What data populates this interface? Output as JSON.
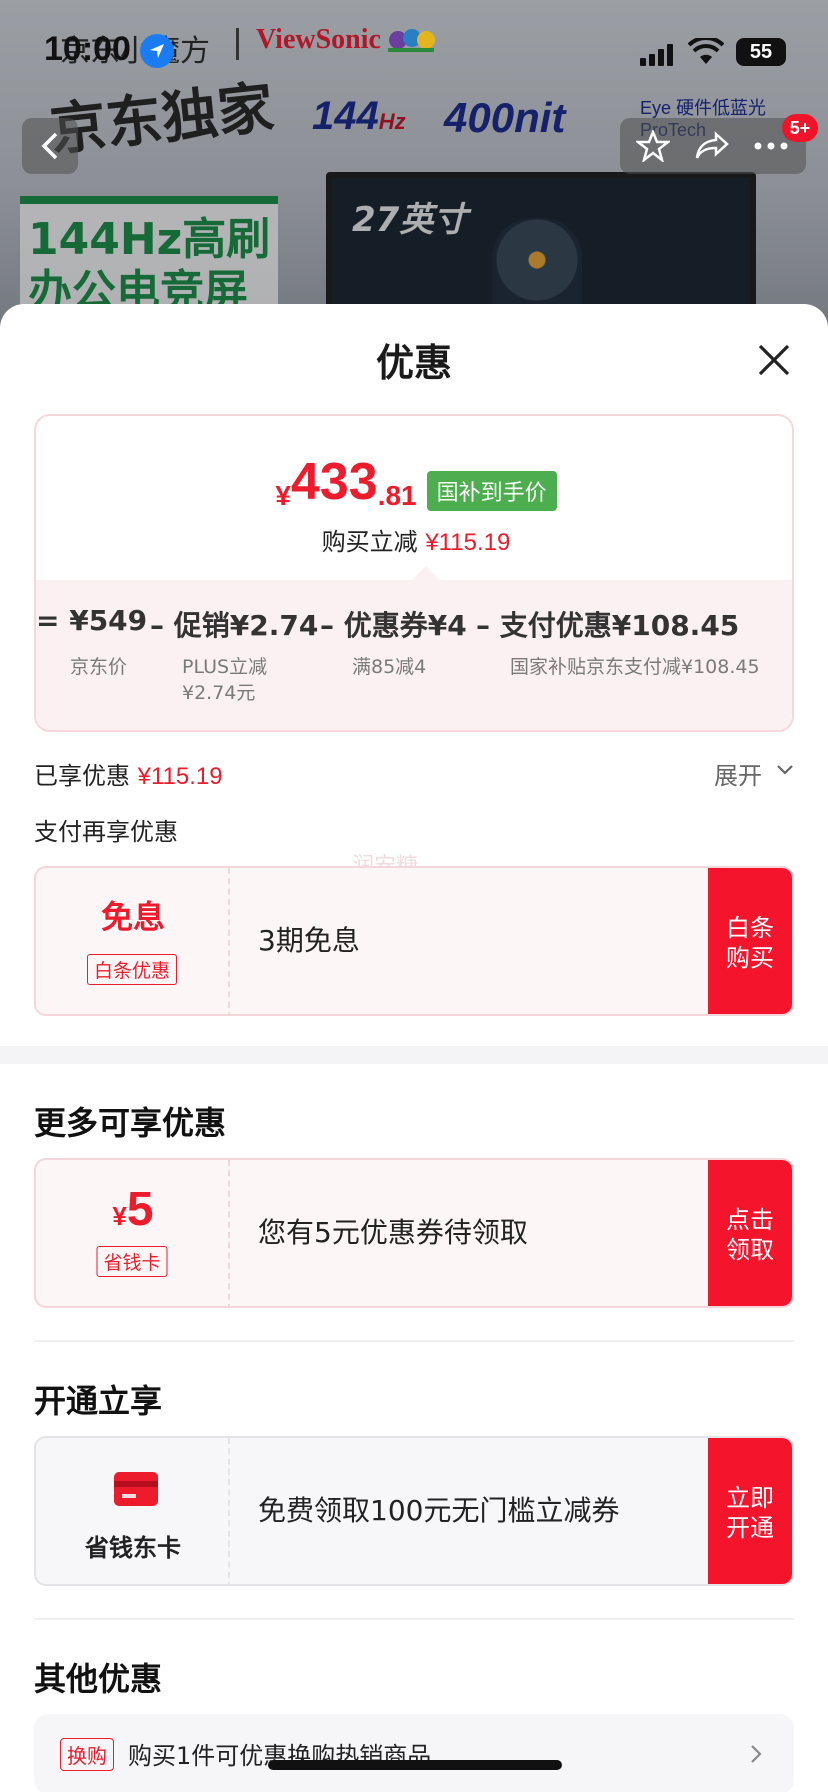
{
  "status_bar": {
    "time": "10:00",
    "battery": "55"
  },
  "banner": {
    "brand": "京东小魔方",
    "viewsonic": "ViewSonic",
    "spec_hz": "144",
    "spec_hz_unit": "Hz",
    "spec_nit": "400nit",
    "eye_label": "Eye 硬件低蓝光 ProTech",
    "exclusive": "京东独家",
    "green_text": "144Hz高刷办公电竞屏",
    "monitor_label": "27英寸"
  },
  "nav": {
    "badge": "5+"
  },
  "sheet": {
    "title": "优惠",
    "price_card": {
      "currency": "¥",
      "price_int": "433",
      "price_dec": ".81",
      "gov_tag": "国补到手价",
      "instant_label": "购买立减",
      "instant_value": "¥115.19",
      "breakdown": [
        {
          "line": "= ¥549",
          "sub": "京东价"
        },
        {
          "line": "– 促销¥2.74",
          "sub": "PLUS立减\n¥2.74元"
        },
        {
          "line": "– 优惠券¥4",
          "sub": "满85减4"
        },
        {
          "line": "– 支付优惠¥108.45",
          "sub": "国家补贴京东支付减¥108.45"
        }
      ]
    },
    "enjoyed_label": "已享优惠",
    "enjoyed_value": "¥115.19",
    "expand_label": "展开",
    "pay_more_label": "支付再享优惠",
    "watermark": "润安糖",
    "baitiao": {
      "big": "免息",
      "tag": "白条优惠",
      "text": "3期免息",
      "button": "白条购买"
    },
    "more_title": "更多可享优惠",
    "coupon": {
      "currency": "¥",
      "amount": "5",
      "tag": "省钱卡",
      "text": "您有5元优惠券待领取",
      "button": "点击领取"
    },
    "open_title": "开通立享",
    "card": {
      "label": "省钱东卡",
      "text": "免费领取100元无门槛立减券",
      "button": "立即开通"
    },
    "other_title": "其他优惠",
    "other": {
      "tag": "换购",
      "text": "购买1件可优惠换购热销商品"
    }
  },
  "colors": {
    "accent_red": "#ec1c2c",
    "button_red": "#f4142c",
    "gov_green": "#4cae4f"
  }
}
